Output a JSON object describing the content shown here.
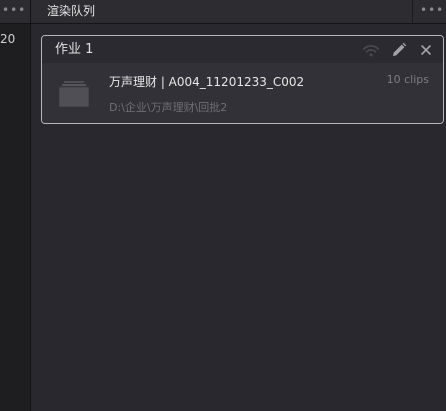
{
  "left_panel": {
    "menu_icon": "more-horizontal-icon",
    "cropped_value": "20"
  },
  "render_queue": {
    "title": "渲染队列",
    "menu_icon": "more-horizontal-icon",
    "jobs": [
      {
        "title": "作业 1",
        "actions": [
          "remote-render-icon",
          "edit-pencil-icon",
          "close-icon"
        ],
        "clip_name": "万声理财 | A004_11201233_C002",
        "clip_count": "10 clips",
        "path": "D:\\企业\\万声理财\\回批2"
      }
    ]
  },
  "colors": {
    "panel_bg": "#28282e",
    "header_bg": "#2c2c31",
    "card_border": "#b8b8bc",
    "card_body_bg": "#313137"
  }
}
